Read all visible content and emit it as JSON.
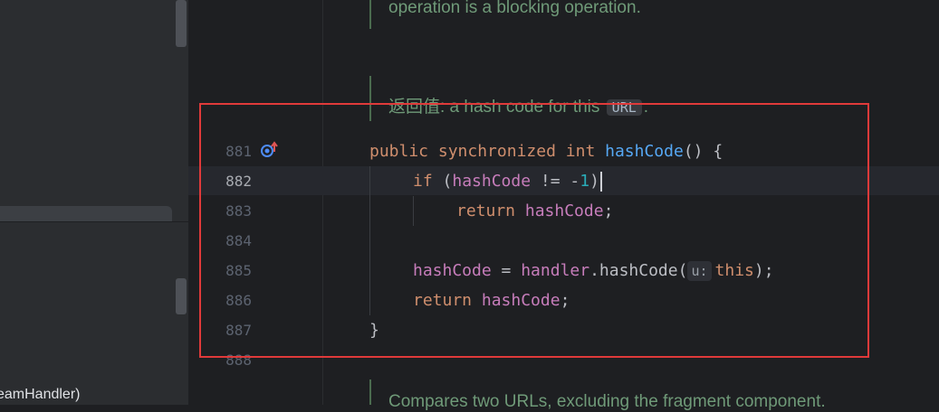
{
  "project_panel": {
    "partial_item": "eamHandler)"
  },
  "doc_top": {
    "text": "operation is a blocking operation."
  },
  "doc_return": {
    "label": "返回值:",
    "text": " a hash code for this ",
    "code": "URL",
    "trailing": "."
  },
  "doc_bottom": {
    "text": "Compares two URLs, excluding the fragment component."
  },
  "editor": {
    "line_numbers": [
      "881",
      "882",
      "883",
      "884",
      "885",
      "886",
      "887",
      "888"
    ],
    "current_line": "882",
    "gutter_icon": "override-implementation-icon",
    "code": {
      "l881": {
        "k1": "public",
        "k2": "synchronized",
        "k3": "int",
        "fn": "hashCode",
        "rest": "() {"
      },
      "l882": {
        "kw": "if",
        "open": "(",
        "field": "hashCode",
        "op": " != -",
        "num": "1",
        "close": ")"
      },
      "l883": {
        "kw": "return",
        "field": "hashCode",
        "semi": ";"
      },
      "l885": {
        "field": "hashCode",
        "eq": " = ",
        "obj": "handler",
        "call": ".hashCode(",
        "hint": "u:",
        "arg": "this",
        "end": ");"
      },
      "l886": {
        "kw": "return",
        "field": "hashCode",
        "semi": ";"
      },
      "l887": {
        "brace": "}"
      }
    }
  },
  "colors": {
    "keyword": "#cf8e6d",
    "function": "#56a8f5",
    "field": "#c77dbb",
    "number": "#2aacb8",
    "annotation_box": "#e03a3a"
  }
}
